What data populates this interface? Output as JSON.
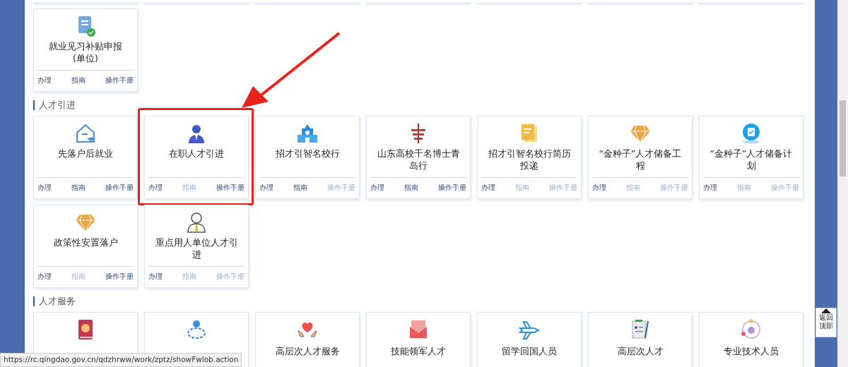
{
  "sections": [
    {
      "cards": [
        {
          "title": "就业见习补贴申报(单位)",
          "highlighted": false,
          "links": [
            {
              "label": "办理",
              "disabled": false
            },
            {
              "label": "指南",
              "disabled": false
            },
            {
              "label": "操作手册",
              "disabled": false
            }
          ]
        }
      ]
    },
    {
      "title": "人才引进",
      "cards": [
        {
          "title": "先落户后就业",
          "highlighted": false,
          "links": [
            {
              "label": "办理",
              "disabled": false
            },
            {
              "label": "指南",
              "disabled": false
            },
            {
              "label": "操作手册",
              "disabled": false
            }
          ]
        },
        {
          "title": "在职人才引进",
          "highlighted": true,
          "links": [
            {
              "label": "办理",
              "disabled": false
            },
            {
              "label": "指南",
              "disabled": true
            },
            {
              "label": "操作手册",
              "disabled": false
            }
          ]
        },
        {
          "title": "招才引智名校行",
          "highlighted": false,
          "links": [
            {
              "label": "办理",
              "disabled": false
            },
            {
              "label": "指南",
              "disabled": false
            },
            {
              "label": "操作手册",
              "disabled": true
            }
          ]
        },
        {
          "title": "山东高校千名博士青岛行",
          "highlighted": false,
          "links": [
            {
              "label": "办理",
              "disabled": false
            },
            {
              "label": "指南",
              "disabled": false
            },
            {
              "label": "操作手册",
              "disabled": false
            }
          ]
        },
        {
          "title": "招才引智名校行简历投递",
          "highlighted": false,
          "links": [
            {
              "label": "办理",
              "disabled": false
            },
            {
              "label": "指南",
              "disabled": true
            },
            {
              "label": "操作手册",
              "disabled": true
            }
          ]
        },
        {
          "title": "“金种子”人才储备工程",
          "highlighted": false,
          "links": [
            {
              "label": "办理",
              "disabled": false
            },
            {
              "label": "指南",
              "disabled": true
            },
            {
              "label": "操作手册",
              "disabled": true
            }
          ]
        },
        {
          "title": "“金种子”人才储备计划",
          "highlighted": false,
          "links": [
            {
              "label": "办理",
              "disabled": false
            },
            {
              "label": "指南",
              "disabled": true
            },
            {
              "label": "操作手册",
              "disabled": true
            }
          ]
        },
        {
          "title": "政策性安置落户",
          "highlighted": false,
          "links": [
            {
              "label": "办理",
              "disabled": false
            },
            {
              "label": "指南",
              "disabled": true
            },
            {
              "label": "操作手册",
              "disabled": false
            }
          ]
        },
        {
          "title": "重点用人单位人才引进",
          "highlighted": false,
          "links": [
            {
              "label": "办理",
              "disabled": false
            },
            {
              "label": "指南",
              "disabled": true
            },
            {
              "label": "操作手册",
              "disabled": true
            }
          ]
        }
      ]
    },
    {
      "title": "人才服务",
      "cards": [
        {
          "highlighted": false
        },
        {
          "highlighted": false
        },
        {
          "title": "高层次人才服务",
          "highlighted": false
        },
        {
          "title": "技能领军人才",
          "highlighted": false
        },
        {
          "title": "留学回国人员",
          "highlighted": false
        },
        {
          "title": "高层次人才",
          "highlighted": false
        },
        {
          "title": "专业技术人员",
          "highlighted": false
        }
      ]
    }
  ],
  "back_to_top": {
    "label": "返回顶部"
  },
  "status_bar": {
    "url": "https://rc.qingdao.gov.cn/qdzhrww/work/zptz/showFwlob.action"
  }
}
